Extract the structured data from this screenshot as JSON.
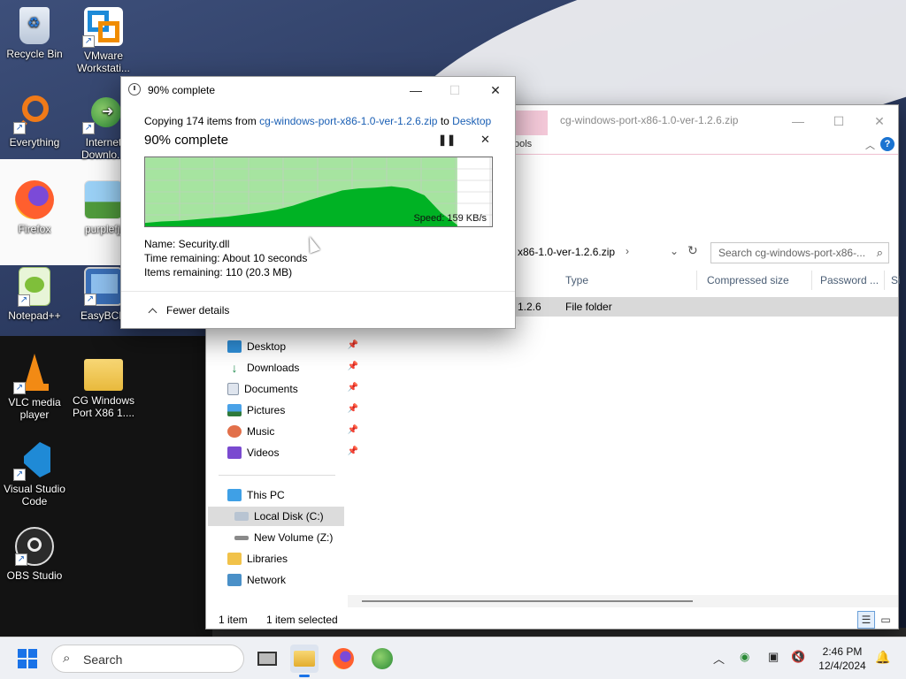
{
  "desktop": {
    "icons": [
      {
        "label": "Recycle Bin"
      },
      {
        "label": "VMware Workstati..."
      },
      {
        "label": "Everything"
      },
      {
        "label": "Internet Downlo..."
      },
      {
        "label": "Firefox"
      },
      {
        "label": "purplefjj"
      },
      {
        "label": "Notepad++"
      },
      {
        "label": "EasyBCD"
      },
      {
        "label": "VLC media player"
      },
      {
        "label": "CG Windows Port X86 1...."
      },
      {
        "label": "Visual Studio Code"
      },
      {
        "label": "OBS Studio"
      }
    ]
  },
  "explorer": {
    "title": "cg-windows-port-x86-1.0-ver-1.2.6.zip",
    "ribbon_tab": "ools",
    "address": "x86-1.0-ver-1.2.6.zip",
    "search_placeholder": "Search cg-windows-port-x86-...",
    "columns": [
      "Type",
      "Compressed size",
      "Password ...",
      "Si"
    ],
    "file_row": {
      "name": "1.2.6",
      "type": "File folder"
    },
    "nav": {
      "quick_access": [
        {
          "label": "Desktop"
        },
        {
          "label": "Downloads"
        },
        {
          "label": "Documents"
        },
        {
          "label": "Pictures"
        },
        {
          "label": "Music"
        },
        {
          "label": "Videos"
        }
      ],
      "this_pc": "This PC",
      "local_disk": "Local Disk (C:)",
      "new_volume": "New Volume (Z:)",
      "libraries": "Libraries",
      "network": "Network"
    },
    "status": {
      "items": "1 item",
      "selected": "1 item selected"
    }
  },
  "copy_dialog": {
    "title": "90% complete",
    "copying_prefix": "Copying 174 items from ",
    "source": "cg-windows-port-x86-1.0-ver-1.2.6.zip",
    "to_word": " to ",
    "destination": "Desktop",
    "percent_label": "90% complete",
    "progress_fraction": 0.9,
    "speed": "Speed: 159 KB/s",
    "name_line": "Name:  Security.dll",
    "time_line": "Time remaining:  About 10 seconds",
    "items_line": "Items remaining:  110 (20.3 MB)",
    "fewer_details": "Fewer details",
    "colors": {
      "graph_fill": "#00b224",
      "graph_bg": "#a6e4a0",
      "link": "#1a5fb4"
    }
  },
  "taskbar": {
    "search_label": "Search",
    "time": "2:46 PM",
    "date": "12/4/2024"
  }
}
